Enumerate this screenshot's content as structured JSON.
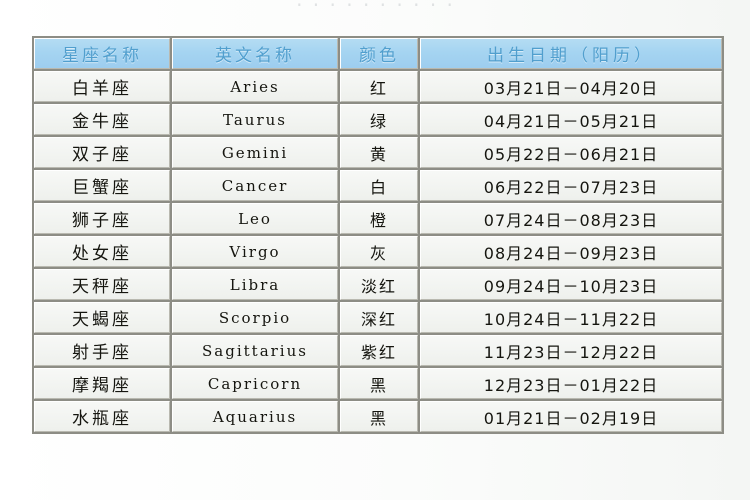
{
  "top_sliver_text": "· · · ·   · ·   · · · ·",
  "table": {
    "columns": [
      {
        "key": "name",
        "label": "星座名称"
      },
      {
        "key": "en",
        "label": "英文名称"
      },
      {
        "key": "color",
        "label": "颜色"
      },
      {
        "key": "date",
        "label": "出生日期（阳历）"
      }
    ],
    "rows": [
      {
        "name": "白羊座",
        "en": "Aries",
        "color": "红",
        "date": "03月21日－04月20日"
      },
      {
        "name": "金牛座",
        "en": "Taurus",
        "color": "绿",
        "date": "04月21日－05月21日"
      },
      {
        "name": "双子座",
        "en": "Gemini",
        "color": "黄",
        "date": "05月22日－06月21日"
      },
      {
        "name": "巨蟹座",
        "en": "Cancer",
        "color": "白",
        "date": "06月22日－07月23日"
      },
      {
        "name": "狮子座",
        "en": "Leo",
        "color": "橙",
        "date": "07月24日－08月23日"
      },
      {
        "name": "处女座",
        "en": "Virgo",
        "color": "灰",
        "date": "08月24日－09月23日"
      },
      {
        "name": "天秤座",
        "en": "Libra",
        "color": "淡红",
        "date": "09月24日－10月23日"
      },
      {
        "name": "天蝎座",
        "en": "Scorpio",
        "color": "深红",
        "date": "10月24日－11月22日"
      },
      {
        "name": "射手座",
        "en": "Sagittarius",
        "color": "紫红",
        "date": "11月23日－12月22日"
      },
      {
        "name": "摩羯座",
        "en": "Capricorn",
        "color": "黑",
        "date": "12月23日－01月22日"
      },
      {
        "name": "水瓶座",
        "en": "Aquarius",
        "color": "黑",
        "date": "01月21日－02月19日"
      }
    ]
  },
  "colors": {
    "header_fill": "#a4d4f2",
    "header_text": "#4f9fd0",
    "cell_fill": "#f2f4f1",
    "cell_text": "#15150f",
    "grid_line": "#8d8d85",
    "page_background": "#ffffff"
  }
}
